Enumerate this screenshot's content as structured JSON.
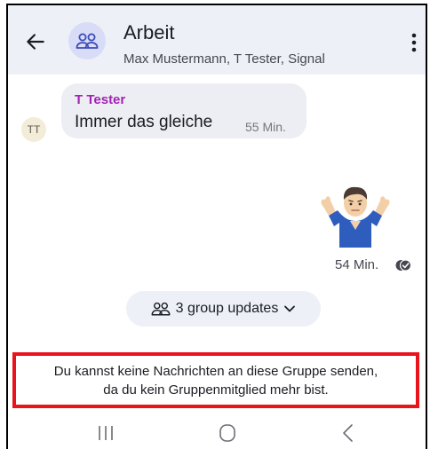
{
  "header": {
    "title": "Arbeit",
    "subtitle": "Max Mustermann, T Tester, Signal",
    "back_icon": "arrow-left-icon",
    "group_icon": "group-icon",
    "menu_icon": "more-vert-icon"
  },
  "messages": [
    {
      "direction": "incoming",
      "avatar_initials": "TT",
      "sender": "T Tester",
      "text": "Immer das gleiche",
      "time": "55 Min."
    },
    {
      "direction": "outgoing",
      "sticker": "shrugging-person-sticker",
      "time": "54 Min.",
      "status_icon": "delivered-check-icon"
    }
  ],
  "group_updates": {
    "label": "3 group updates",
    "icon": "group-icon",
    "chevron": "chevron-down-icon"
  },
  "notice": {
    "line1": "Du kannst keine Nachrichten an diese Gruppe senden,",
    "line2": "da du kein Gruppenmitglied mehr bist."
  },
  "navbar": {
    "recents_icon": "recents-icon",
    "home_icon": "home-icon",
    "back_icon": "back-chevron-icon"
  },
  "colors": {
    "header_bg": "#eef0f8",
    "sender_name": "#a521b5",
    "notice_border": "#e8141c",
    "bubble_bg": "#eceef3"
  }
}
